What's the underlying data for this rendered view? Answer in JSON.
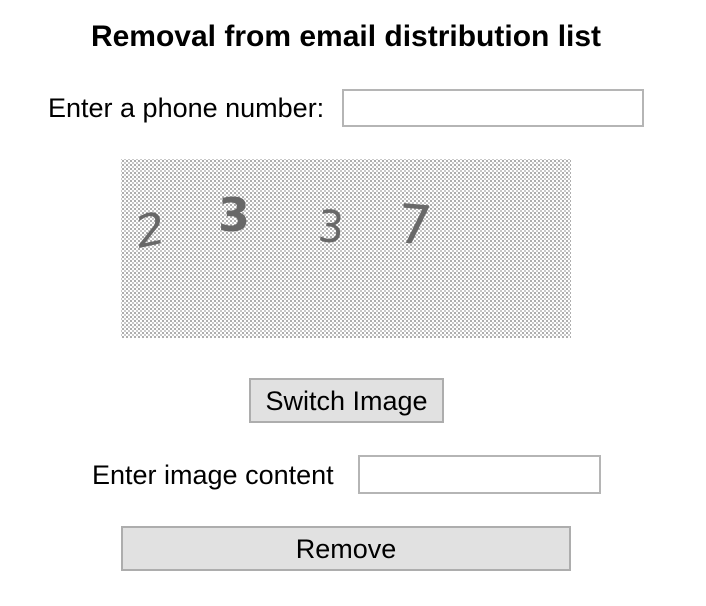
{
  "form": {
    "title": "Removal from email distribution list",
    "phone_label": "Enter a phone number:",
    "phone_value": "",
    "phone_placeholder": "",
    "captcha": {
      "digits": [
        "2",
        "3",
        "3",
        "7"
      ],
      "digit_color": "#686868"
    },
    "switch_label": "Switch Image",
    "content_label": "Enter image content",
    "content_value": "",
    "content_placeholder": "",
    "remove_label": "Remove"
  }
}
